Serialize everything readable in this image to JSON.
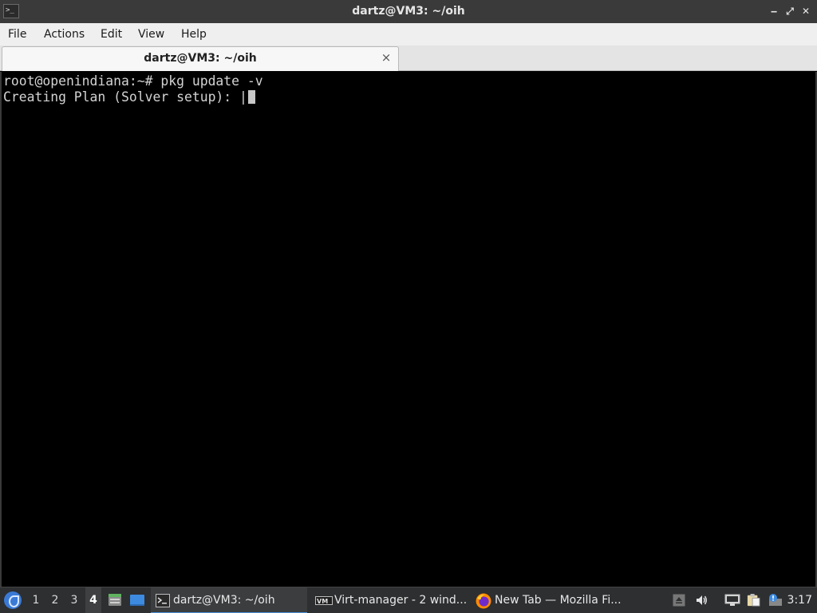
{
  "window": {
    "title": "dartz@VM3: ~/oih",
    "app_icon_glyph": ">_",
    "controls": {
      "minimize": "‒",
      "maximize": "⤢",
      "close": "✕"
    }
  },
  "menubar": {
    "items": [
      {
        "label": "File"
      },
      {
        "label": "Actions"
      },
      {
        "label": "Edit"
      },
      {
        "label": "View"
      },
      {
        "label": "Help"
      }
    ]
  },
  "tabs": [
    {
      "label": "dartz@VM3: ~/oih",
      "active": true,
      "close_glyph": "×"
    }
  ],
  "terminal": {
    "lines": [
      "root@openindiana:~# pkg update -v",
      "Creating Plan (Solver setup): |"
    ],
    "colors": {
      "background": "#000000",
      "foreground": "#d3d3d3"
    }
  },
  "taskbar": {
    "start_icon": "start-menu-icon",
    "workspaces": [
      {
        "label": "1"
      },
      {
        "label": "2"
      },
      {
        "label": "3"
      },
      {
        "label": "4",
        "active": true
      }
    ],
    "quicklaunch": [
      "file-manager-icon",
      "show-desktop-icon"
    ],
    "tasks": [
      {
        "label": "dartz@VM3: ~/oih",
        "icon": "terminal-icon",
        "active": true
      },
      {
        "label": "Virt-manager - 2 wind...",
        "icon": "virt-manager-icon",
        "active": false
      },
      {
        "label": "New Tab — Mozilla Fi...",
        "icon": "firefox-icon",
        "active": false
      }
    ],
    "tray": [
      "eject-icon",
      "volume-icon",
      "network-icon",
      "clipboard-icon",
      "update-notifier-icon"
    ],
    "clock": "3:17"
  },
  "colors": {
    "titlebar": "#3a3a3a",
    "menubar": "#efefef",
    "taskbar": "#2d2f31",
    "accent": "#4a8fd6"
  }
}
